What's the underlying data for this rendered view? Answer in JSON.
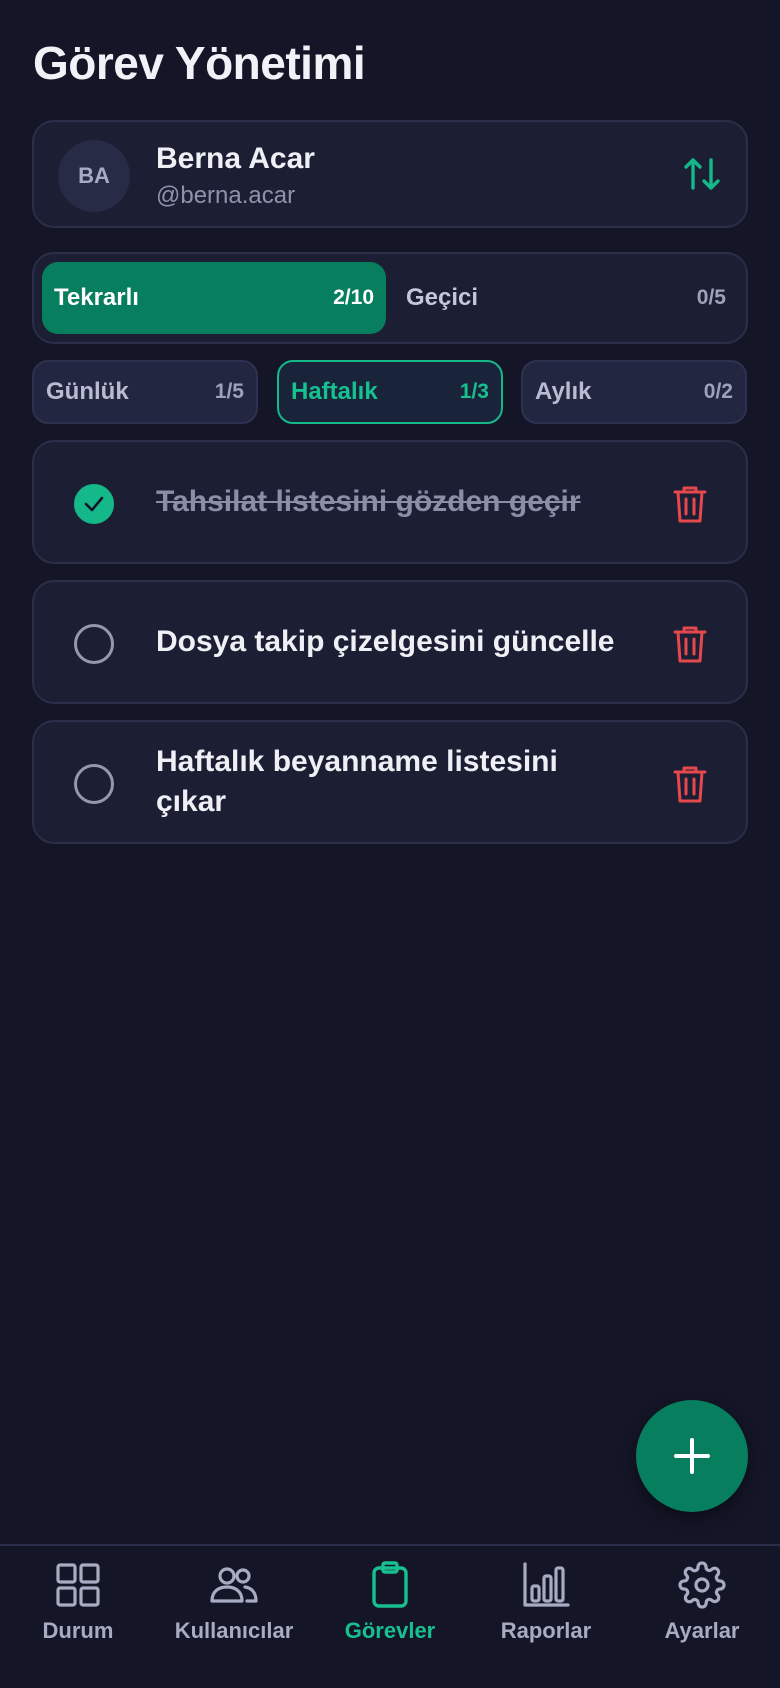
{
  "header": {
    "title": "Görev Yönetimi"
  },
  "user": {
    "initials": "BA",
    "name": "Berna Acar",
    "handle": "@berna.acar"
  },
  "type_tabs": [
    {
      "label": "Tekrarlı",
      "count": "2/10",
      "active": true
    },
    {
      "label": "Geçici",
      "count": "0/5",
      "active": false
    }
  ],
  "period_tabs": [
    {
      "label": "Günlük",
      "count": "1/5",
      "active": false
    },
    {
      "label": "Haftalık",
      "count": "1/3",
      "active": true
    },
    {
      "label": "Aylık",
      "count": "0/2",
      "active": false
    }
  ],
  "tasks": [
    {
      "text": "Tahsilat listesini gözden geçir",
      "done": true
    },
    {
      "text": "Dosya takip çizelgesini güncelle",
      "done": false
    },
    {
      "text": "Haftalık beyanname listesini çıkar",
      "done": false
    }
  ],
  "nav": [
    {
      "label": "Durum",
      "icon": "grid-icon"
    },
    {
      "label": "Kullanıcılar",
      "icon": "users-icon"
    },
    {
      "label": "Görevler",
      "icon": "clipboard-icon",
      "active": true
    },
    {
      "label": "Raporlar",
      "icon": "bar-chart-icon"
    },
    {
      "label": "Ayarlar",
      "icon": "gear-icon"
    }
  ],
  "colors": {
    "accent": "#077e5e",
    "accent_bright": "#14b889",
    "danger": "#e5484d",
    "background": "#141628",
    "card": "#1c1e33"
  }
}
